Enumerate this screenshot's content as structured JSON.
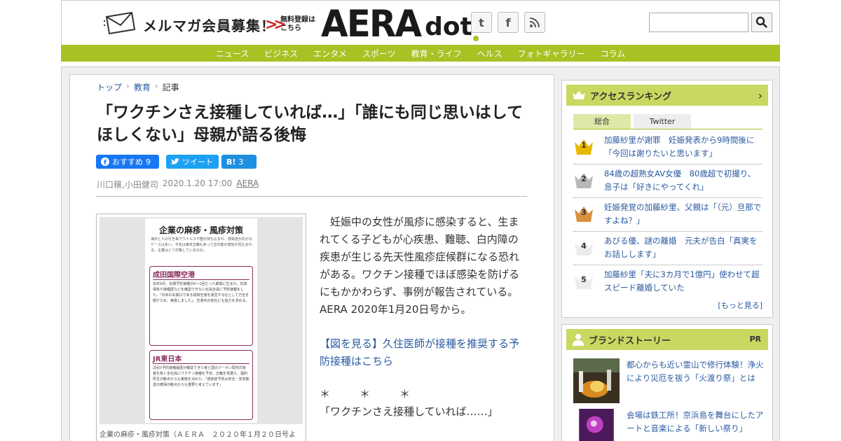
{
  "header": {
    "mailmag_label": "メルマガ会員募集！",
    "free_reg_line1": "無料登録は",
    "free_reg_line2": "こちら",
    "logo_main": "AERA",
    "logo_sub": "dot",
    "social": [
      {
        "label": "t",
        "icon": "twitter-icon"
      },
      {
        "label": "f",
        "icon": "facebook-icon"
      },
      {
        "label": "",
        "icon": "rss-icon"
      }
    ],
    "search_placeholder": ""
  },
  "nav": {
    "items": [
      "ニュース",
      "ビジネス",
      "エンタメ",
      "スポーツ",
      "教育・ライフ",
      "ヘルス",
      "フォトギャラリー",
      "コラム"
    ]
  },
  "breadcrumb": {
    "items": [
      "トップ",
      "教育",
      "記事"
    ]
  },
  "article": {
    "title": "「ワクチンさえ接種していれば…」「誰にも同じ思いはしてほしくない」母親が語る後悔",
    "share": {
      "fb_label": "おすすめ",
      "fb_count": "9",
      "tw_label": "ツイート",
      "hb_label": "B!",
      "hb_count": "3"
    },
    "byline": {
      "authors": "川口穣,小田健司",
      "datetime": "2020.1.20 17:00",
      "source": "AERA"
    },
    "figure": {
      "heading": "企業の麻疹・風疹対策",
      "intro": "海外と人の行き来でウイルスや菌が持ち込まれ、感染症が広がるケースは多い。今年は東京五輪もあって訪日客の増加が見込まれる。企業はどう対策しているのか。",
      "box1_title": "成田国際空港",
      "box1_text": "去年9月、定期予防接種が0～1回だった期間に生まれ、抗体保有や接種歴などを確認できない社員全員に予防接種をした。「日本の玄関口である成田空港を運営する社として万全を期すため、実施しました」。空港内の他社にも協力を求める。",
      "box2_title": "JR東日本",
      "box2_text": "2回の予防接種履歴が確認できた者と国のクーポン配布対象者を除く全社員にワクチン接種を予定。五輪を見据え、福利厚生の観点からも実施を決めた。「感染症予防は安全・安定輸送の確保の観点からも重要と考えています」",
      "caption": "企業の麻疹・風疹対策（ＡＥＲＡ　２０２０年１月２０日号よ"
    },
    "body_paragraph": "妊娠中の女性が風疹に感染すると、生まれてくる子どもが心疾患、難聴、白内障の疾患が生じる先天性風疹症候群になる恐れがある。ワクチン接種でほぼ感染を防げるにもかかわらず、事例が報告されている。AERA 2020年1月20日号から。",
    "body_link": "【図を見る】久住医師が接種を推奨する予防接種はこちら",
    "body_stars": "＊　　＊　　＊",
    "body_quote": "「ワクチンさえ接種していれば……」"
  },
  "ranking": {
    "title": "アクセスランキング",
    "tabs": [
      "総合",
      "Twitter"
    ],
    "items": [
      {
        "rank": "1",
        "text": "加藤紗里が謝罪　妊娠発表から9時間後に「今回は謝りたいと思います」",
        "color": "#e6b800"
      },
      {
        "rank": "2",
        "text": "84歳の超熟女AV女優　80歳超で初撮り、息子は「好きにやってくれ」",
        "color": "#b0b0b0"
      },
      {
        "rank": "3",
        "text": "妊娠発覚の加藤紗里、父親は「（元）旦那ですよね？」",
        "color": "#d08a3a"
      },
      {
        "rank": "4",
        "text": "あびる優、謎の離婚　元夫が告白「真実をお話しします」",
        "color": "#e6e6e6"
      },
      {
        "rank": "5",
        "text": "加藤紗里「夫に3カ月で1億円」使わせて超スピード離婚していた",
        "color": "#e6e6e6"
      }
    ],
    "more": "[もっと見る]"
  },
  "brand": {
    "title": "ブランドストーリー",
    "pr": "PR",
    "stories": [
      {
        "text": "都心からも近い霊山で修行体験！浄火により災厄を祓う「火渡り祭」とは"
      },
      {
        "text": "会場は鉄工所！京浜島を舞台にしたアートと音楽による「新しい祭り」"
      }
    ]
  },
  "colors": {
    "accent_green": "#a8c224",
    "link_blue": "#2a5aa0",
    "ranking_header": "#c8d860"
  }
}
